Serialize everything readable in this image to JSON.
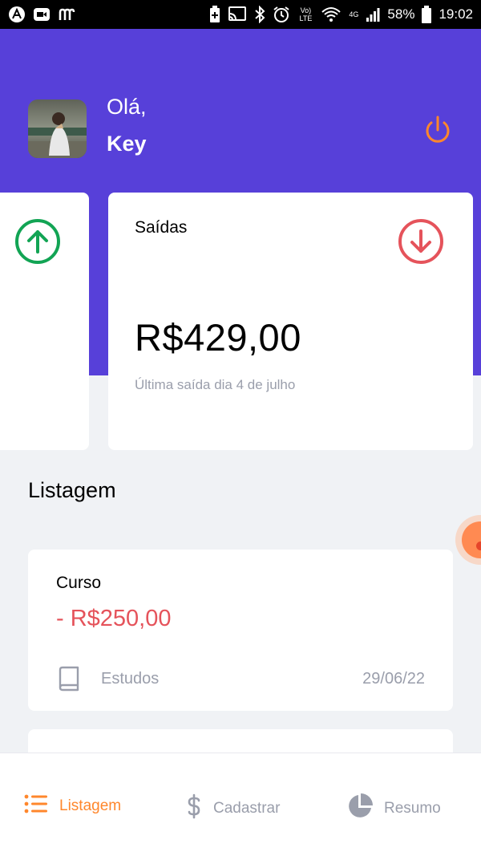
{
  "status_bar": {
    "battery": "58%",
    "time": "19:02",
    "network": "4G",
    "volte": "Vo) LTE"
  },
  "header": {
    "greeting": "Olá,",
    "user_name": "Key"
  },
  "cards": {
    "outflow": {
      "title": "Saídas",
      "amount": "R$429,00",
      "subtitle": "Última saída dia 4 de julho"
    }
  },
  "listing": {
    "title": "Listagem",
    "transactions": [
      {
        "title": "Curso",
        "amount": "- R$250,00",
        "category": "Estudos",
        "date": "29/06/22"
      }
    ]
  },
  "tabbar": {
    "tabs": [
      {
        "label": "Listagem",
        "icon": "list-icon",
        "active": true
      },
      {
        "label": "Cadastrar",
        "icon": "dollar-icon",
        "active": false
      },
      {
        "label": "Resumo",
        "icon": "pie-chart-icon",
        "active": false
      }
    ]
  },
  "colors": {
    "primary": "#5740d9",
    "accent": "#ff872c",
    "income": "#12a454",
    "outcome": "#e5535b",
    "background": "#f0f2f5",
    "muted": "#9a9eab"
  }
}
